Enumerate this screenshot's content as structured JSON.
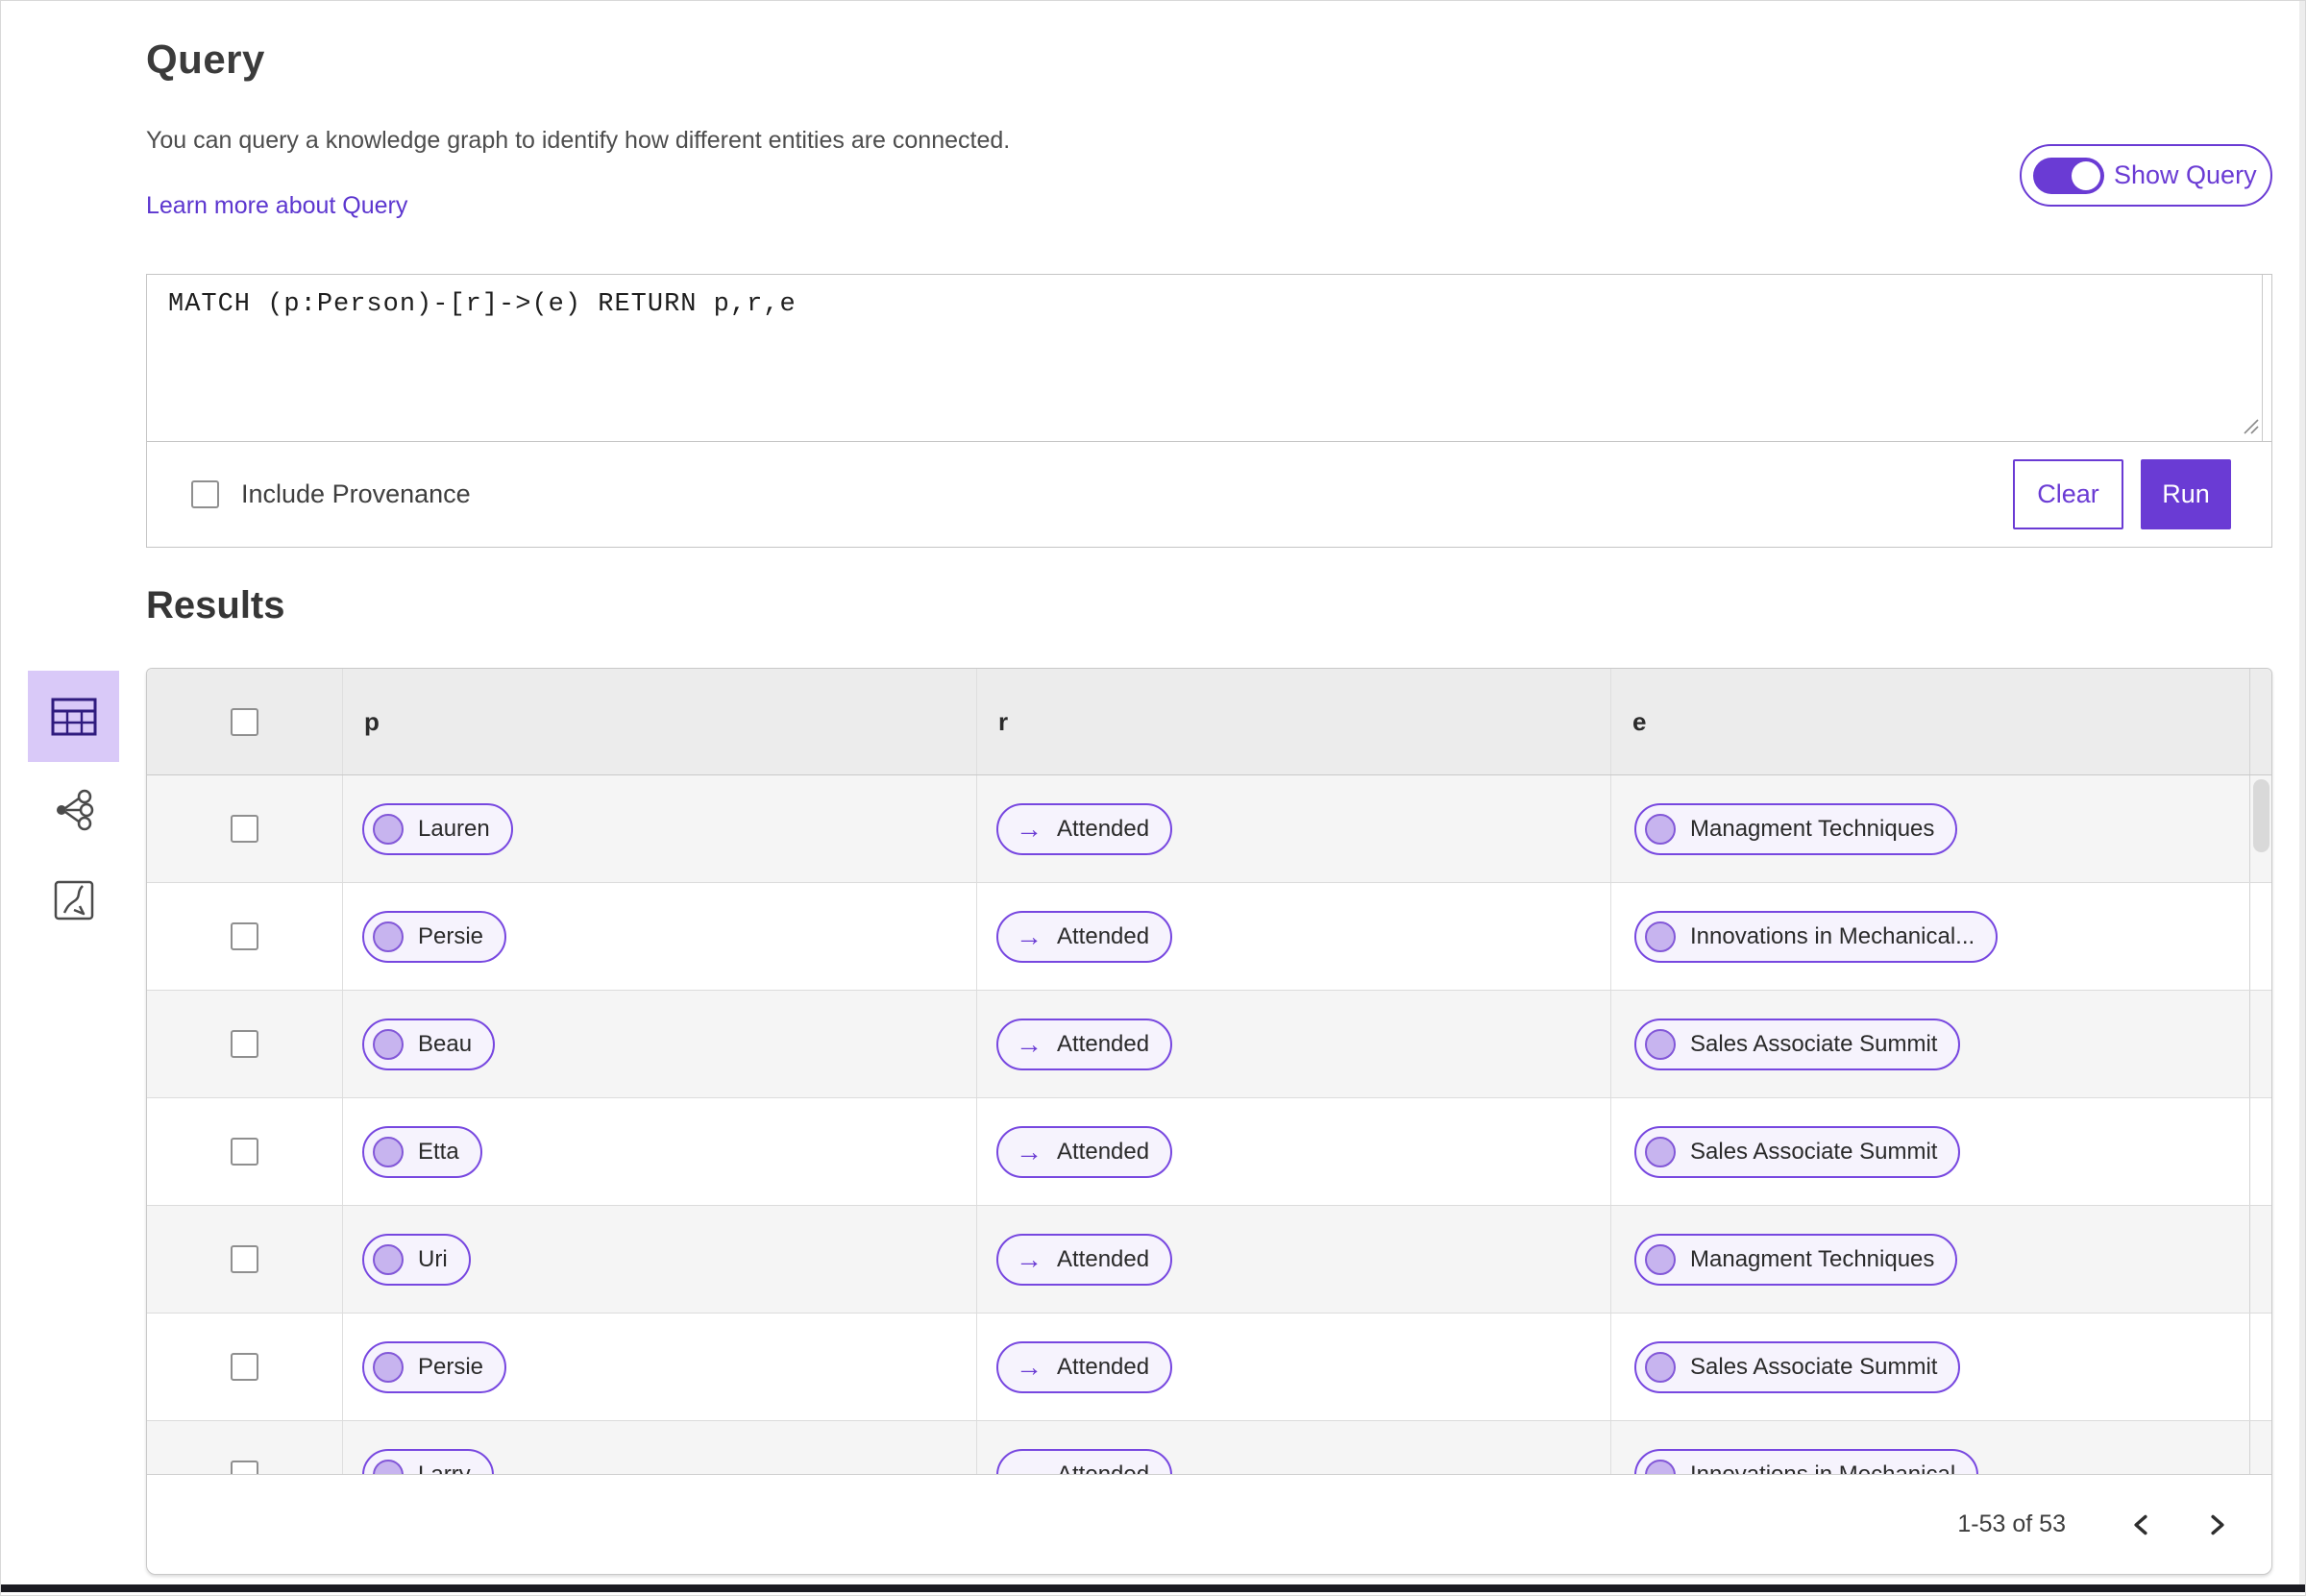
{
  "header": {
    "title": "Query",
    "description": "You can query a knowledge graph to identify how different entities are connected.",
    "learn_more_link": "Learn more about Query",
    "show_query_label": "Show Query",
    "show_query_state": "on"
  },
  "query_editor": {
    "query_text": "MATCH (p:Person)-[r]->(e) RETURN p,r,e",
    "include_provenance_label": "Include Provenance",
    "include_provenance_checked": false,
    "clear_button_label": "Clear",
    "run_button_label": "Run"
  },
  "results": {
    "title": "Results",
    "views": [
      {
        "icon": "table-view-icon",
        "active": true
      },
      {
        "icon": "graph-view-icon",
        "active": false
      },
      {
        "icon": "map-view-icon",
        "active": false
      }
    ],
    "columns": [
      "p",
      "r",
      "e"
    ],
    "relation_arrow": "→",
    "rows": [
      {
        "p": "Lauren",
        "r": "Attended",
        "e": "Managment Techniques"
      },
      {
        "p": "Persie",
        "r": "Attended",
        "e": "Innovations in Mechanical..."
      },
      {
        "p": "Beau",
        "r": "Attended",
        "e": "Sales Associate Summit"
      },
      {
        "p": "Etta",
        "r": "Attended",
        "e": "Sales Associate Summit"
      },
      {
        "p": "Uri",
        "r": "Attended",
        "e": "Managment Techniques"
      },
      {
        "p": "Persie",
        "r": "Attended",
        "e": "Sales Associate Summit"
      },
      {
        "p": "Larry",
        "r": "Attended",
        "e": "Innovations in Mechanical"
      }
    ],
    "pagination": {
      "range_label": "1-53 of 53"
    }
  },
  "colors": {
    "accent_purple": "#6a3bd4",
    "pill_border": "#7747e0",
    "pill_background": "#f6f3fd",
    "node_dot_fill": "#c7b4ef",
    "active_view_background": "#d9c9f8",
    "header_row_background": "#ececec",
    "alt_row_background": "#f5f5f5"
  }
}
